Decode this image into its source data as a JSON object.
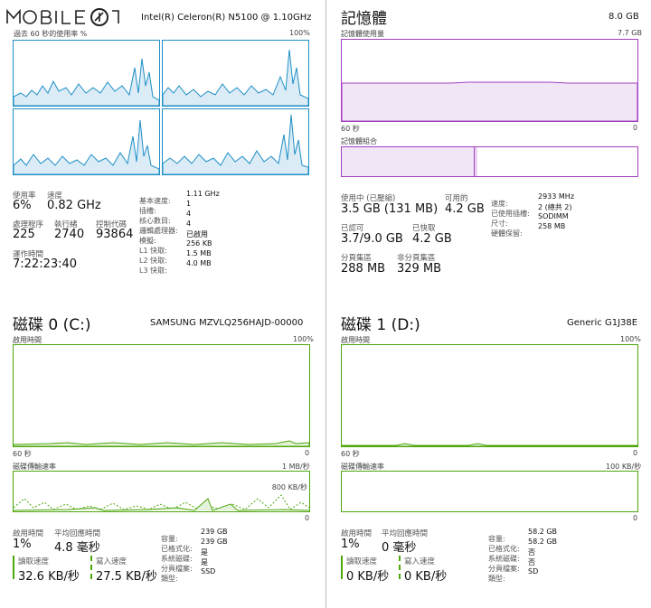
{
  "logo": {
    "text": "MOBILE01"
  },
  "cpu": {
    "model": "Intel(R) Celeron(R) N5100 @ 1.10GHz",
    "graph_label": "過去 60 秒的使用率 %",
    "graph_max": "100%",
    "util_label": "使用率",
    "util_value": "6%",
    "speed_label": "速度",
    "speed_value": "0.82 GHz",
    "proc_label": "處理程序",
    "proc_value": "225",
    "thread_label": "執行緒",
    "thread_value": "2740",
    "handle_label": "控制代碼",
    "handle_value": "93864",
    "uptime_label": "運作時間",
    "uptime_value": "7:22:23:40",
    "specs": [
      {
        "k": "基本速度:",
        "v": "1.11 GHz"
      },
      {
        "k": "插槽:",
        "v": "1"
      },
      {
        "k": "核心數目:",
        "v": "4"
      },
      {
        "k": "邏輯處理器:",
        "v": "4"
      },
      {
        "k": "模擬:",
        "v": "已啟用"
      },
      {
        "k": "L1 快取:",
        "v": "256 KB"
      },
      {
        "k": "L2 快取:",
        "v": "1.5 MB"
      },
      {
        "k": "L3 快取:",
        "v": "4.0 MB"
      }
    ]
  },
  "memory": {
    "title": "記憶體",
    "total": "8.0 GB",
    "usage_label": "記憶體使用量",
    "usage_max": "7.7 GB",
    "axis_left": "60 秒",
    "axis_right": "0",
    "composition_label": "記憶體組合",
    "inuse_label": "使用中 (已壓縮)",
    "inuse_value": "3.5 GB (131 MB)",
    "avail_label": "可用的",
    "avail_value": "4.2 GB",
    "committed_label": "已認可",
    "committed_value": "3.7/9.0 GB",
    "cached_label": "已快取",
    "cached_value": "4.2 GB",
    "paged_label": "分頁集區",
    "paged_value": "288 MB",
    "nonpaged_label": "非分頁集區",
    "nonpaged_value": "329 MB",
    "specs": [
      {
        "k": "速度:",
        "v": "2933 MHz"
      },
      {
        "k": "已使用插槽:",
        "v": "2 (總共 2)"
      },
      {
        "k": "尺寸:",
        "v": "SODIMM"
      },
      {
        "k": "硬體保留:",
        "v": "258 MB"
      }
    ]
  },
  "disk0": {
    "title": "磁碟 0 (C:)",
    "model": "SAMSUNG MZVLQ256HAJD-00000",
    "active_label": "啟用時間",
    "active_max": "100%",
    "axis_left": "60 秒",
    "axis_right": "0",
    "transfer_label": "磁碟傳輸速率",
    "transfer_max": "1 MB/秒",
    "transfer_mid": "800 KB/秒",
    "active_time_label": "啟用時間",
    "active_time_value": "1%",
    "resp_label": "平均回應時間",
    "resp_value": "4.8 毫秒",
    "read_label": "讀取速度",
    "read_value": "32.6 KB/秒",
    "write_label": "寫入速度",
    "write_value": "27.5 KB/秒",
    "specs": [
      {
        "k": "容量:",
        "v": "239 GB"
      },
      {
        "k": "已格式化:",
        "v": "239 GB"
      },
      {
        "k": "系統磁碟:",
        "v": "是"
      },
      {
        "k": "分頁檔案:",
        "v": "是"
      },
      {
        "k": "類型:",
        "v": "SSD"
      }
    ]
  },
  "disk1": {
    "title": "磁碟 1 (D:)",
    "model": "Generic G1J38E",
    "active_label": "啟用時間",
    "active_max": "100%",
    "axis_left": "60 秒",
    "axis_right": "0",
    "transfer_label": "磁碟傳輸速率",
    "transfer_max": "100 KB/秒",
    "active_time_label": "啟用時間",
    "active_time_value": "1%",
    "resp_label": "平均回應時間",
    "resp_value": "0 毫秒",
    "read_label": "讀取速度",
    "read_value": "0 KB/秒",
    "write_label": "寫入速度",
    "write_value": "0 KB/秒",
    "specs": [
      {
        "k": "容量:",
        "v": "58.2 GB"
      },
      {
        "k": "已格式化:",
        "v": "58.2 GB"
      },
      {
        "k": "系統磁碟:",
        "v": "否"
      },
      {
        "k": "分頁檔案:",
        "v": "否"
      },
      {
        "k": "類型:",
        "v": "SD"
      }
    ]
  },
  "colors": {
    "cpu": "#1e8fc6",
    "memory": "#a43ec0",
    "disk": "#4da60c"
  }
}
